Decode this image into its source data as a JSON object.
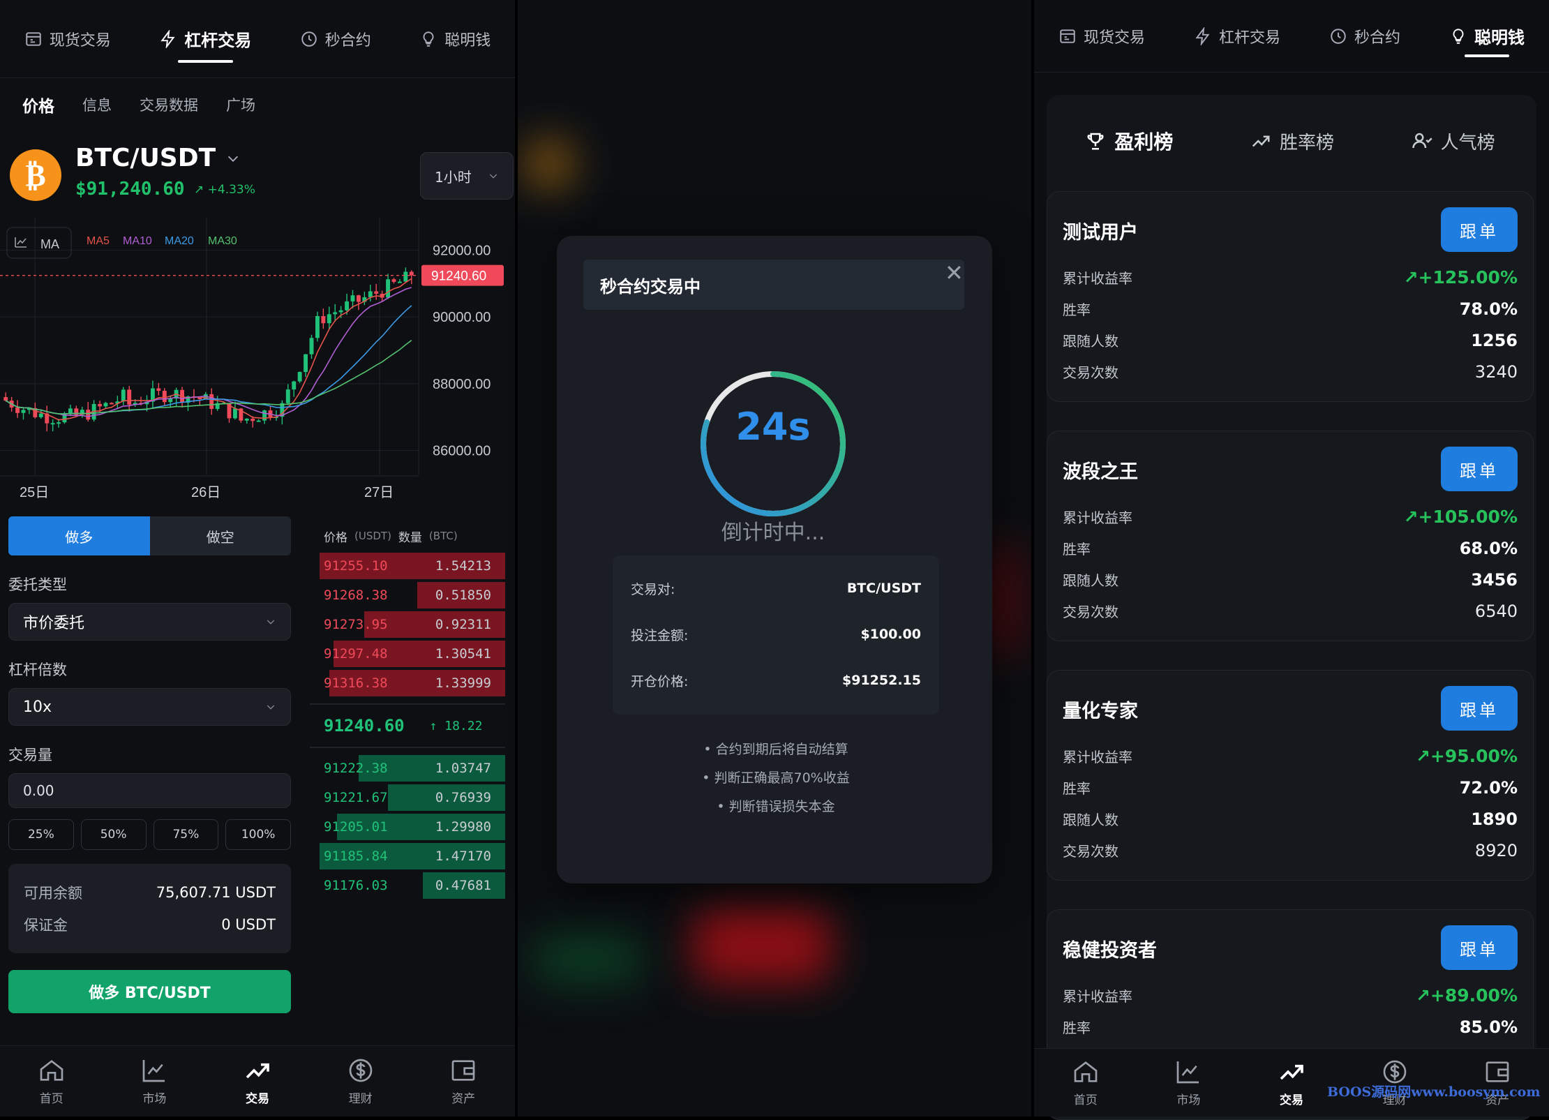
{
  "top_tabs": [
    "现货交易",
    "杠杆交易",
    "秒合约",
    "聪明钱"
  ],
  "sub_tabs": [
    "价格",
    "信息",
    "交易数据",
    "广场"
  ],
  "ticker": {
    "pair": "BTC/USDT",
    "price": "$91,240.60",
    "change": "+4.33%",
    "timeframe": "1小时",
    "coin_symbol": "₿"
  },
  "chart": {
    "indicator": "MA",
    "ma": [
      "MA5",
      "MA10",
      "MA20",
      "MA30"
    ],
    "ma_colors": [
      "#e5534b",
      "#b15fd4",
      "#3b9be8",
      "#54c16f"
    ],
    "y_ticks": [
      "92000.00",
      "90000.00",
      "88000.00",
      "86000.00"
    ],
    "x_ticks": [
      "25日",
      "26日",
      "27日"
    ],
    "last_price_tag": "91240.60"
  },
  "chart_data": {
    "type": "candlestick",
    "x": [
      "25日",
      "26日",
      "27日"
    ],
    "ylim": [
      85200,
      92800
    ],
    "last": 91240.6,
    "y_ticks": [
      92000,
      90000,
      88000,
      86000
    ]
  },
  "order_form": {
    "long_label": "做多",
    "short_label": "做空",
    "type_label": "委托类型",
    "type_value": "市价委托",
    "leverage_label": "杠杆倍数",
    "leverage_value": "10x",
    "amount_label": "交易量",
    "amount_value": "0.00",
    "pcts": [
      "25%",
      "50%",
      "75%",
      "100%"
    ],
    "available_label": "可用余额",
    "available_value": "75,607.71 USDT",
    "margin_label": "保证金",
    "margin_value": "0 USDT",
    "submit_label": "做多 BTC/USDT"
  },
  "orderbook": {
    "price_h": "价格",
    "price_unit": "(USDT)",
    "qty_h": "数量",
    "qty_unit": "(BTC)",
    "asks": [
      {
        "p": "91255.10",
        "q": "1.54213",
        "d": 0.95
      },
      {
        "p": "91268.38",
        "q": "0.51850",
        "d": 0.45
      },
      {
        "p": "91273.95",
        "q": "0.92311",
        "d": 0.72
      },
      {
        "p": "91297.48",
        "q": "1.30541",
        "d": 0.88
      },
      {
        "p": "91316.38",
        "q": "1.33999",
        "d": 0.9
      }
    ],
    "mid_price": "91240.60",
    "mid_change": "↑ 18.22",
    "bids": [
      {
        "p": "91222.38",
        "q": "1.03747",
        "d": 0.75
      },
      {
        "p": "91221.67",
        "q": "0.76939",
        "d": 0.6
      },
      {
        "p": "91205.01",
        "q": "1.29980",
        "d": 0.86
      },
      {
        "p": "91185.84",
        "q": "1.47170",
        "d": 0.95
      },
      {
        "p": "91176.03",
        "q": "0.47681",
        "d": 0.42
      }
    ]
  },
  "bottom_nav": [
    "首页",
    "市场",
    "交易",
    "理财",
    "资产"
  ],
  "modal": {
    "title": "秒合约交易中",
    "countdown": "24s",
    "countdown_text": "倒计时中...",
    "progress": 0.8,
    "pair_label": "交易对:",
    "pair_value": "BTC/USDT",
    "amount_label": "投注金额:",
    "amount_value": "$100.00",
    "open_label": "开仓价格:",
    "open_value": "$91252.15",
    "notes": [
      "• 合约到期后将自动结算",
      "• 判断正确最高70%收益",
      "• 判断错误损失本金"
    ]
  },
  "rank_tabs": [
    "盈利榜",
    "胜率榜",
    "人气榜"
  ],
  "traders": [
    {
      "name": "测试用户",
      "follow": "跟单",
      "roi": "+125.00%",
      "winrate": "78.0%",
      "followers": "1256",
      "trades": "3240"
    },
    {
      "name": "波段之王",
      "follow": "跟单",
      "roi": "+105.00%",
      "winrate": "68.0%",
      "followers": "3456",
      "trades": "6540"
    },
    {
      "name": "量化专家",
      "follow": "跟单",
      "roi": "+95.00%",
      "winrate": "72.0%",
      "followers": "1890",
      "trades": "8920"
    },
    {
      "name": "稳健投资者",
      "follow": "跟单",
      "roi": "+89.00%",
      "winrate": "85.0%"
    }
  ],
  "stat_labels": {
    "roi": "累计收益率",
    "winrate": "胜率",
    "followers": "跟随人数",
    "trades": "交易次数"
  },
  "watermark": "BOOS源码网www.boosym.com"
}
